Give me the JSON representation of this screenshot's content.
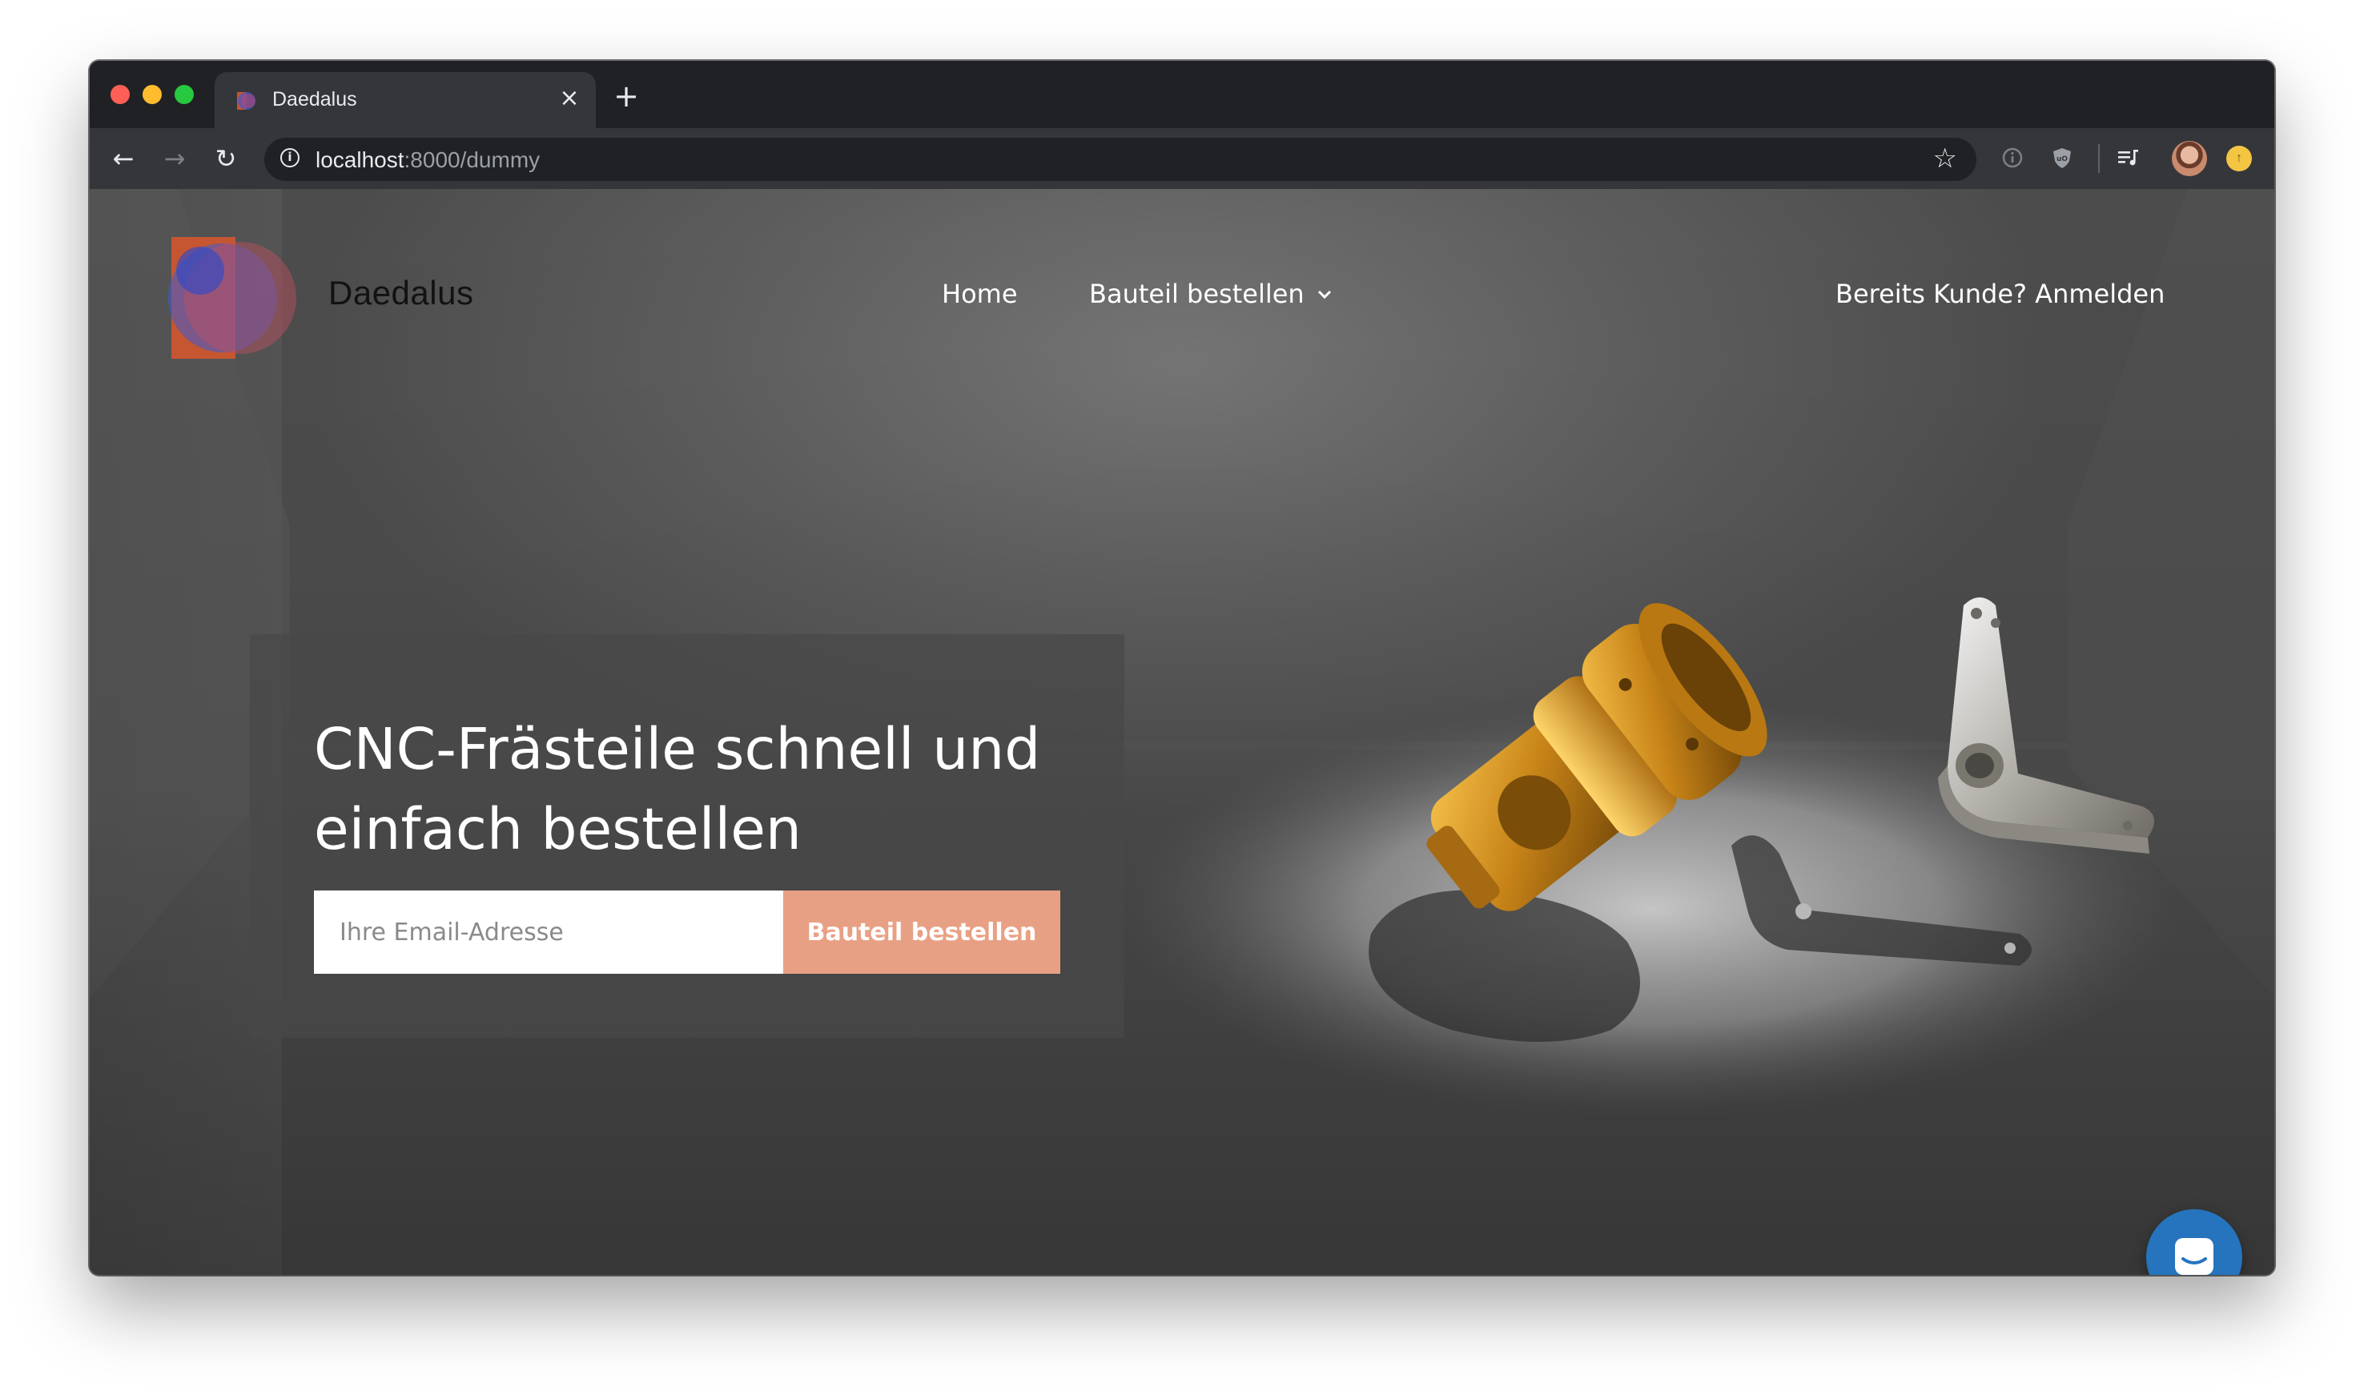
{
  "browser": {
    "tab": {
      "title": "Daedalus",
      "favicon_icon": "daedalus-favicon-icon",
      "close_glyph": "×"
    },
    "new_tab_glyph": "+",
    "toolbar": {
      "back_glyph": "←",
      "forward_glyph": "→",
      "reload_glyph": "↻",
      "info_glyph": "i",
      "url_host": "localhost",
      "url_rest": ":8000/dummy",
      "bookmark_glyph": "☆",
      "extensions": [
        "info-circle-icon",
        "ublock-shield-icon",
        "media-queue-icon"
      ],
      "avatar_icon": "user-avatar-icon",
      "update_icon": "update-available-icon",
      "update_glyph": "↑"
    }
  },
  "site": {
    "brand": {
      "name": "Daedalus",
      "logo_icon": "daedalus-logo-icon"
    },
    "nav": {
      "home": "Home",
      "order_menu": "Bauteil bestellen",
      "order_menu_icon": "chevron-down-icon",
      "login": "Bereits Kunde? Anmelden"
    },
    "hero": {
      "title": "CNC-Frästeile schnell und einfach bestellen",
      "email_placeholder": "Ihre Email-Adresse",
      "email_value": "",
      "cta": "Bauteil bestellen"
    },
    "chat": {
      "icon": "chat-bubble-icon"
    }
  },
  "colors": {
    "accent": "#e8a084",
    "chat_button": "#2574bd",
    "browser_dark": "#202124",
    "browser_toolbar": "#35363a"
  }
}
